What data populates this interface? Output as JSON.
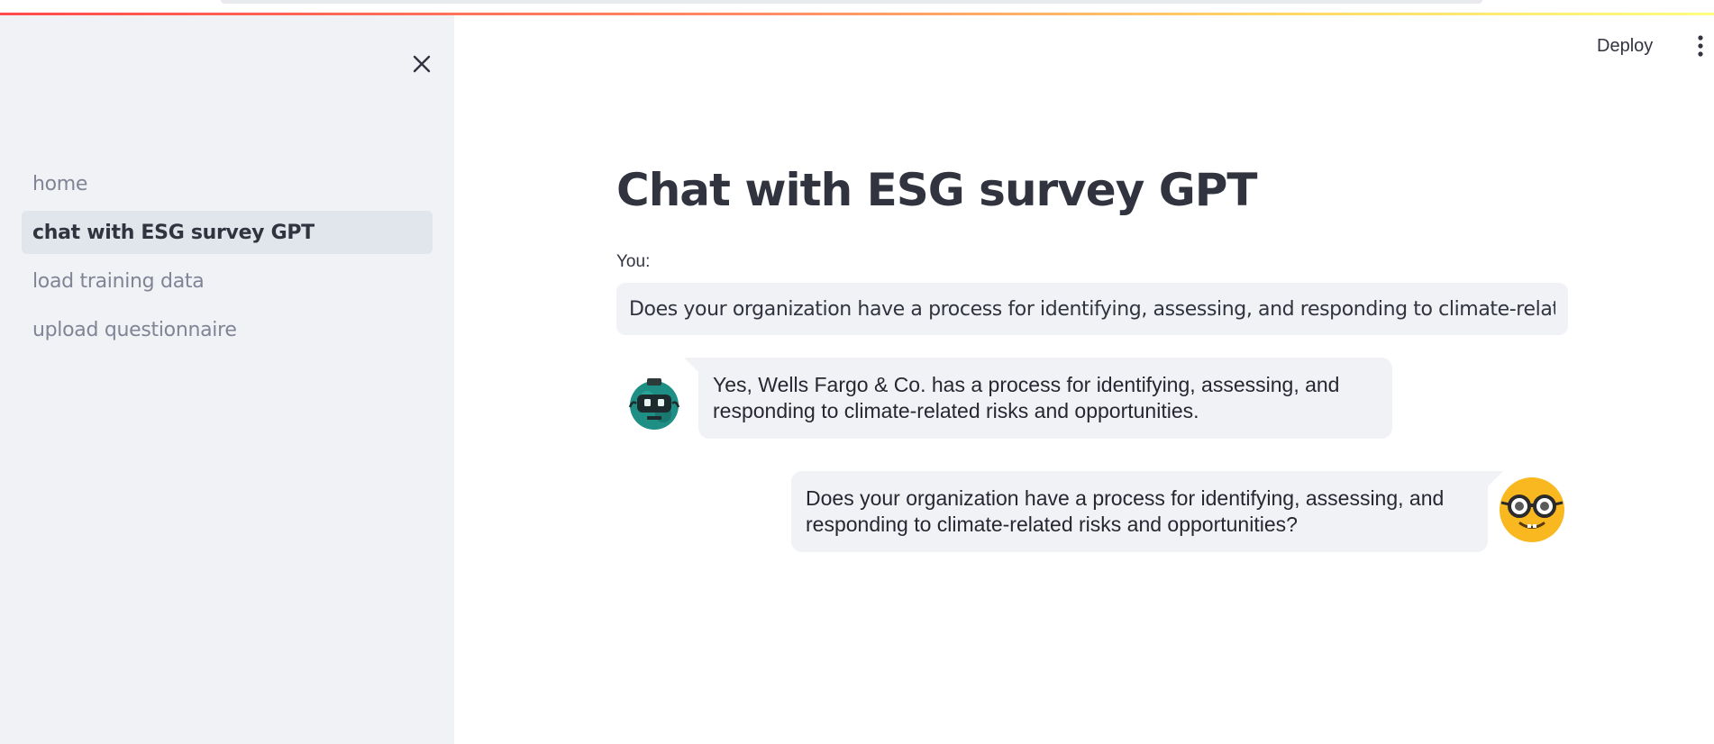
{
  "sidebar": {
    "close_icon": "close-icon",
    "items": [
      {
        "label": "home",
        "active": false
      },
      {
        "label": "chat with ESG survey GPT",
        "active": true
      },
      {
        "label": "load training data",
        "active": false
      },
      {
        "label": "upload questionnaire",
        "active": false
      }
    ]
  },
  "header": {
    "deploy_label": "Deploy",
    "menu_icon": "more-vertical-icon"
  },
  "main": {
    "title": "Chat with ESG survey GPT",
    "input_label": "You:",
    "input_value": "Does your organization have a process for identifying, assessing, and responding to climate-related risks and opportunities?",
    "messages": [
      {
        "role": "bot",
        "avatar": "robot-avatar-icon",
        "text": "Yes, Wells Fargo & Co. has a process for identifying, assessing, and responding to climate-related risks and opportunities."
      },
      {
        "role": "user",
        "avatar": "nerd-face-avatar-icon",
        "text": "Does your organization have a process for identifying, assessing, and responding to climate-related risks and opportunities?"
      }
    ]
  },
  "colors": {
    "sidebar_bg": "#f0f2f6",
    "active_item_bg": "#e1e5ec",
    "bubble_bg": "#f0f2f6",
    "text": "#31333f",
    "muted_text": "#808495",
    "accent_red": "#ff4b4b",
    "accent_yellow": "#fffd80"
  }
}
